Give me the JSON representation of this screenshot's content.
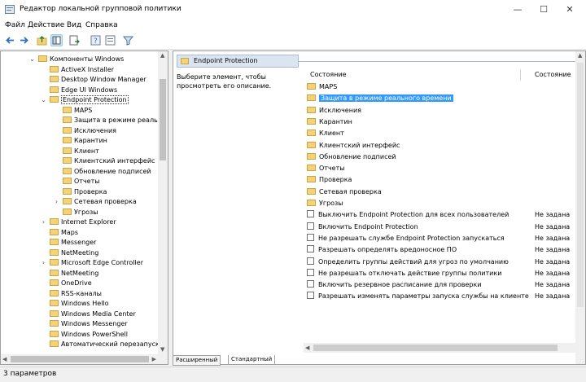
{
  "window": {
    "title": "Редактор локальной групповой политики",
    "minimize": "—",
    "maximize": "☐",
    "close": "✕"
  },
  "menu": [
    "Файл",
    "Действие",
    "Вид",
    "Справка"
  ],
  "toolbar_icons": [
    "back-icon",
    "forward-icon",
    "up-folder-icon",
    "show-tree-icon",
    "export-list-icon",
    "help-icon",
    "properties-icon",
    "filter-icon"
  ],
  "tree": {
    "nodes": [
      {
        "label": "Компоненты Windows",
        "level": 1,
        "expander": "⌄",
        "type": "folder"
      },
      {
        "label": "ActiveX Installer",
        "level": 2,
        "type": "folder"
      },
      {
        "label": "Desktop Window Manager",
        "level": 2,
        "type": "folder"
      },
      {
        "label": "Edge UI Windows",
        "level": 2,
        "type": "folder"
      },
      {
        "label": "Endpoint Protection",
        "level": 2,
        "expander": "⌄",
        "type": "folder",
        "selected": true
      },
      {
        "label": "MAPS",
        "level": 3,
        "type": "folder"
      },
      {
        "label": "Защита в режиме реального",
        "level": 3,
        "type": "folder"
      },
      {
        "label": "Исключения",
        "level": 3,
        "type": "folder"
      },
      {
        "label": "Карантин",
        "level": 3,
        "type": "folder"
      },
      {
        "label": "Клиент",
        "level": 3,
        "type": "folder"
      },
      {
        "label": "Клиентский интерфейс",
        "level": 3,
        "type": "folder"
      },
      {
        "label": "Обновление подписей",
        "level": 3,
        "type": "folder"
      },
      {
        "label": "Отчеты",
        "level": 3,
        "type": "folder"
      },
      {
        "label": "Проверка",
        "level": 3,
        "type": "folder"
      },
      {
        "label": "Сетевая проверка",
        "level": 3,
        "expander": "›",
        "type": "folder"
      },
      {
        "label": "Угрозы",
        "level": 3,
        "type": "folder"
      },
      {
        "label": "Internet Explorer",
        "level": 2,
        "expander": "›",
        "type": "folder"
      },
      {
        "label": "Maps",
        "level": 2,
        "type": "folder"
      },
      {
        "label": "Messenger",
        "level": 2,
        "type": "folder"
      },
      {
        "label": "NetMeeting",
        "level": 2,
        "type": "folder"
      },
      {
        "label": "Microsoft Edge Controller",
        "level": 2,
        "expander": "›",
        "type": "folder"
      },
      {
        "label": "NetMeeting",
        "level": 2,
        "type": "folder"
      },
      {
        "label": "OneDrive",
        "level": 2,
        "type": "folder"
      },
      {
        "label": "RSS-каналы",
        "level": 2,
        "type": "folder"
      },
      {
        "label": "Windows Hello",
        "level": 2,
        "type": "folder"
      },
      {
        "label": "Windows Media Center",
        "level": 2,
        "type": "folder"
      },
      {
        "label": "Windows Messenger",
        "level": 2,
        "type": "folder"
      },
      {
        "label": "Windows PowerShell",
        "level": 2,
        "type": "folder"
      },
      {
        "label": "Автоматический перезапуск",
        "level": 2,
        "type": "folder"
      }
    ]
  },
  "right": {
    "header_title": "Endpoint Protection",
    "description": "Выберите элемент, чтобы просмотреть его описание.",
    "columns": {
      "name": "Состояние",
      "state": "Состояние"
    },
    "col_name_label": "Состояние",
    "rows": [
      {
        "label": "MAPS",
        "type": "folder"
      },
      {
        "label": "Защита в режиме реального времени",
        "type": "folder",
        "selected": true
      },
      {
        "label": "Исключения",
        "type": "folder"
      },
      {
        "label": "Карантин",
        "type": "folder"
      },
      {
        "label": "Клиент",
        "type": "folder"
      },
      {
        "label": "Клиентский интерфейс",
        "type": "folder"
      },
      {
        "label": "Обновление подписей",
        "type": "folder"
      },
      {
        "label": "Отчеты",
        "type": "folder"
      },
      {
        "label": "Проверка",
        "type": "folder"
      },
      {
        "label": "Сетевая проверка",
        "type": "folder"
      },
      {
        "label": "Угрозы",
        "type": "folder"
      },
      {
        "label": "Выключить Endpoint Protection для всех пользователей",
        "type": "policy",
        "state": "Не задана"
      },
      {
        "label": "Включить Endpoint Protection",
        "type": "policy",
        "state": "Не задана"
      },
      {
        "label": "Не разрешать службе Endpoint Protection запускаться",
        "type": "policy",
        "state": "Не задана"
      },
      {
        "label": "Разрешать определять вредоносное ПО",
        "type": "policy",
        "state": "Не задана"
      },
      {
        "label": "Определить группы действий для угроз по умолчанию",
        "type": "policy",
        "state": "Не задана"
      },
      {
        "label": "Не разрешать отключать действие группы политики",
        "type": "policy",
        "state": "Не задана"
      },
      {
        "label": "Включить резервное расписание для проверки",
        "type": "policy",
        "state": "Не задана"
      },
      {
        "label": "Разрешать изменять параметры запуска службы на клиенте",
        "type": "policy",
        "state": "Не задана"
      }
    ]
  },
  "tabs": [
    "Расширенный",
    "Стандартный"
  ],
  "status": "3 параметров"
}
